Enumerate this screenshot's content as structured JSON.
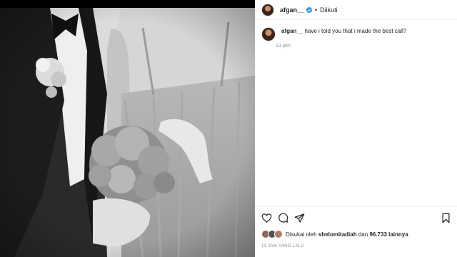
{
  "post": {
    "username": "afgan__",
    "follow_status": "Diikuti",
    "separator": "•",
    "caption": "have i told you that i made the best call?",
    "caption_time": "13 jam",
    "likes": {
      "prefix": "Disukai oleh",
      "liker": "shelomitadiah",
      "middle": "dan",
      "count": "96.733 lainnya"
    },
    "time_ago": "13 JAM YANG LALU"
  },
  "photo": {
    "description_icon": "wedding-photo-image"
  },
  "colors": {
    "text": "#262626",
    "muted": "#8e8e8e",
    "verified": "#3897f0"
  }
}
